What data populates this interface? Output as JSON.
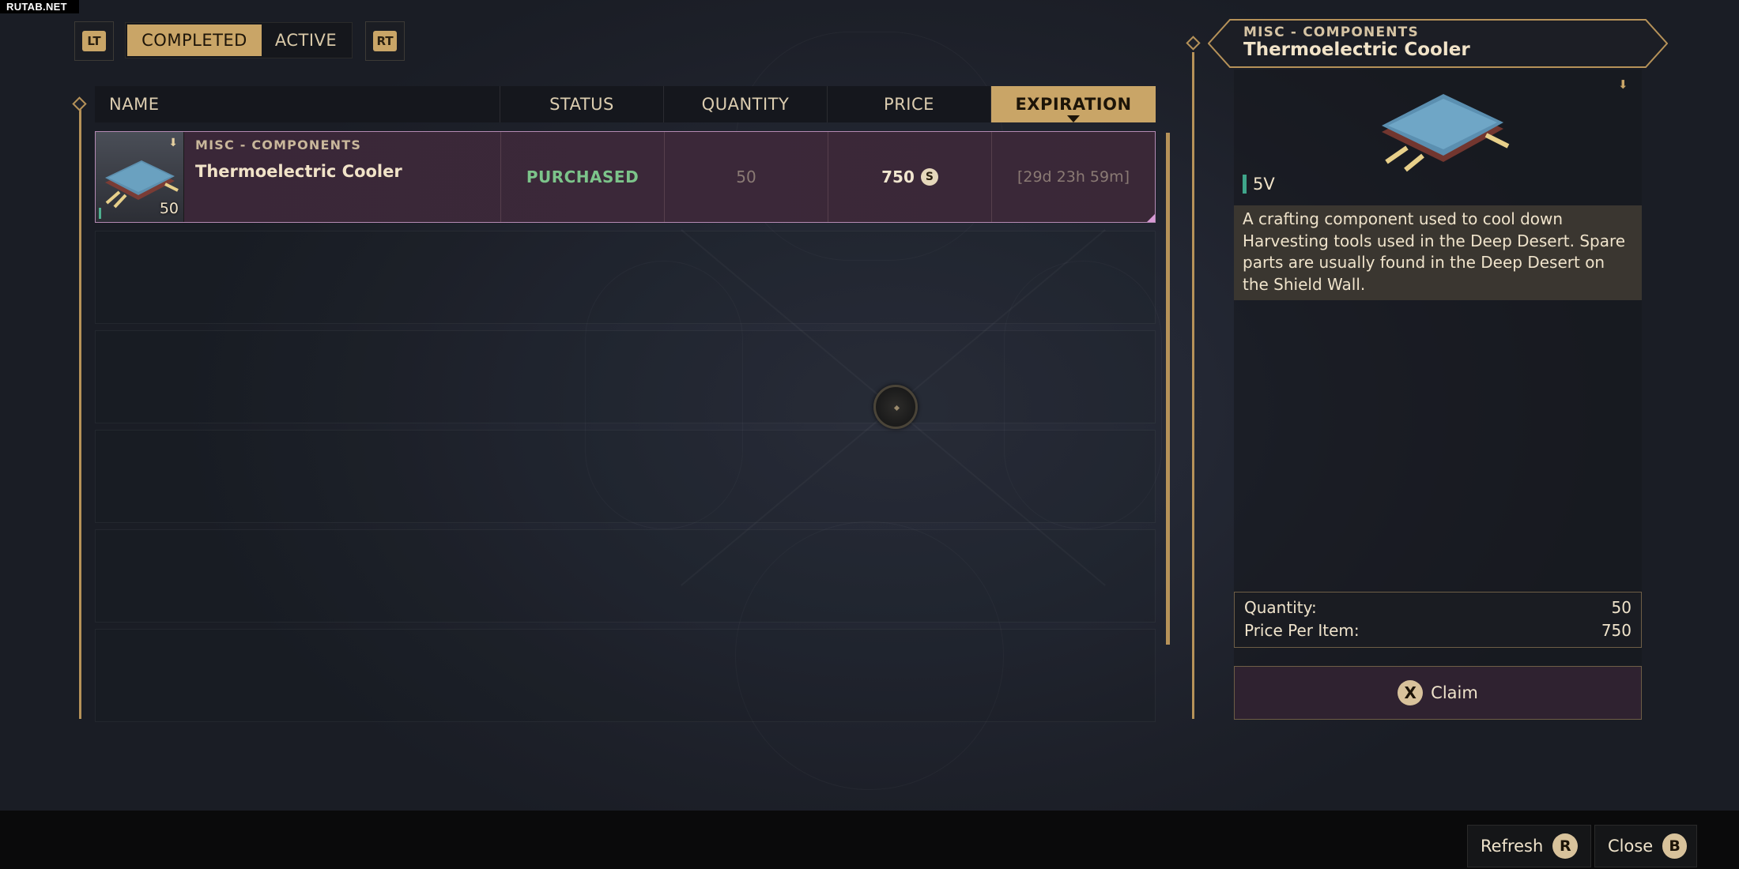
{
  "watermark": "RUTAB.NET",
  "tabs": {
    "left_trigger": "LT",
    "right_trigger": "RT",
    "completed": "COMPLETED",
    "active": "ACTIVE"
  },
  "table": {
    "columns": [
      "NAME",
      "STATUS",
      "QUANTITY",
      "PRICE",
      "EXPIRATION"
    ],
    "sorted_column": "EXPIRATION",
    "rows": [
      {
        "category": "MISC - COMPONENTS",
        "name": "Thermoelectric Cooler",
        "thumb_count": "50",
        "status": "PURCHASED",
        "quantity": "50",
        "price": "750",
        "currency_symbol": "S",
        "expiration": "[29d 23h 59m]"
      }
    ]
  },
  "detail": {
    "category": "MISC - COMPONENTS",
    "title": "Thermoelectric Cooler",
    "voltage": "5V",
    "description": "A crafting component used to cool down Harvesting tools used in the Deep Desert. Spare parts are usually found in the Deep Desert on the Shield Wall.",
    "quantity_label": "Quantity:",
    "quantity_value": "50",
    "price_label": "Price Per Item:",
    "price_value": "750",
    "claim_glyph": "X",
    "claim_label": "Claim"
  },
  "footer": {
    "refresh_label": "Refresh",
    "refresh_glyph": "R",
    "close_label": "Close",
    "close_glyph": "B"
  },
  "colors": {
    "accent_gold": "#c9a567",
    "status_purchased": "#7cc48a",
    "row_highlight": "#3a2738",
    "voltage_indicator": "#3fa58a"
  },
  "icons": {
    "currency": "solari-coin-icon",
    "item_tag": "bookmark-tag-icon",
    "item_image": "thermoelectric-cooler-icon"
  }
}
